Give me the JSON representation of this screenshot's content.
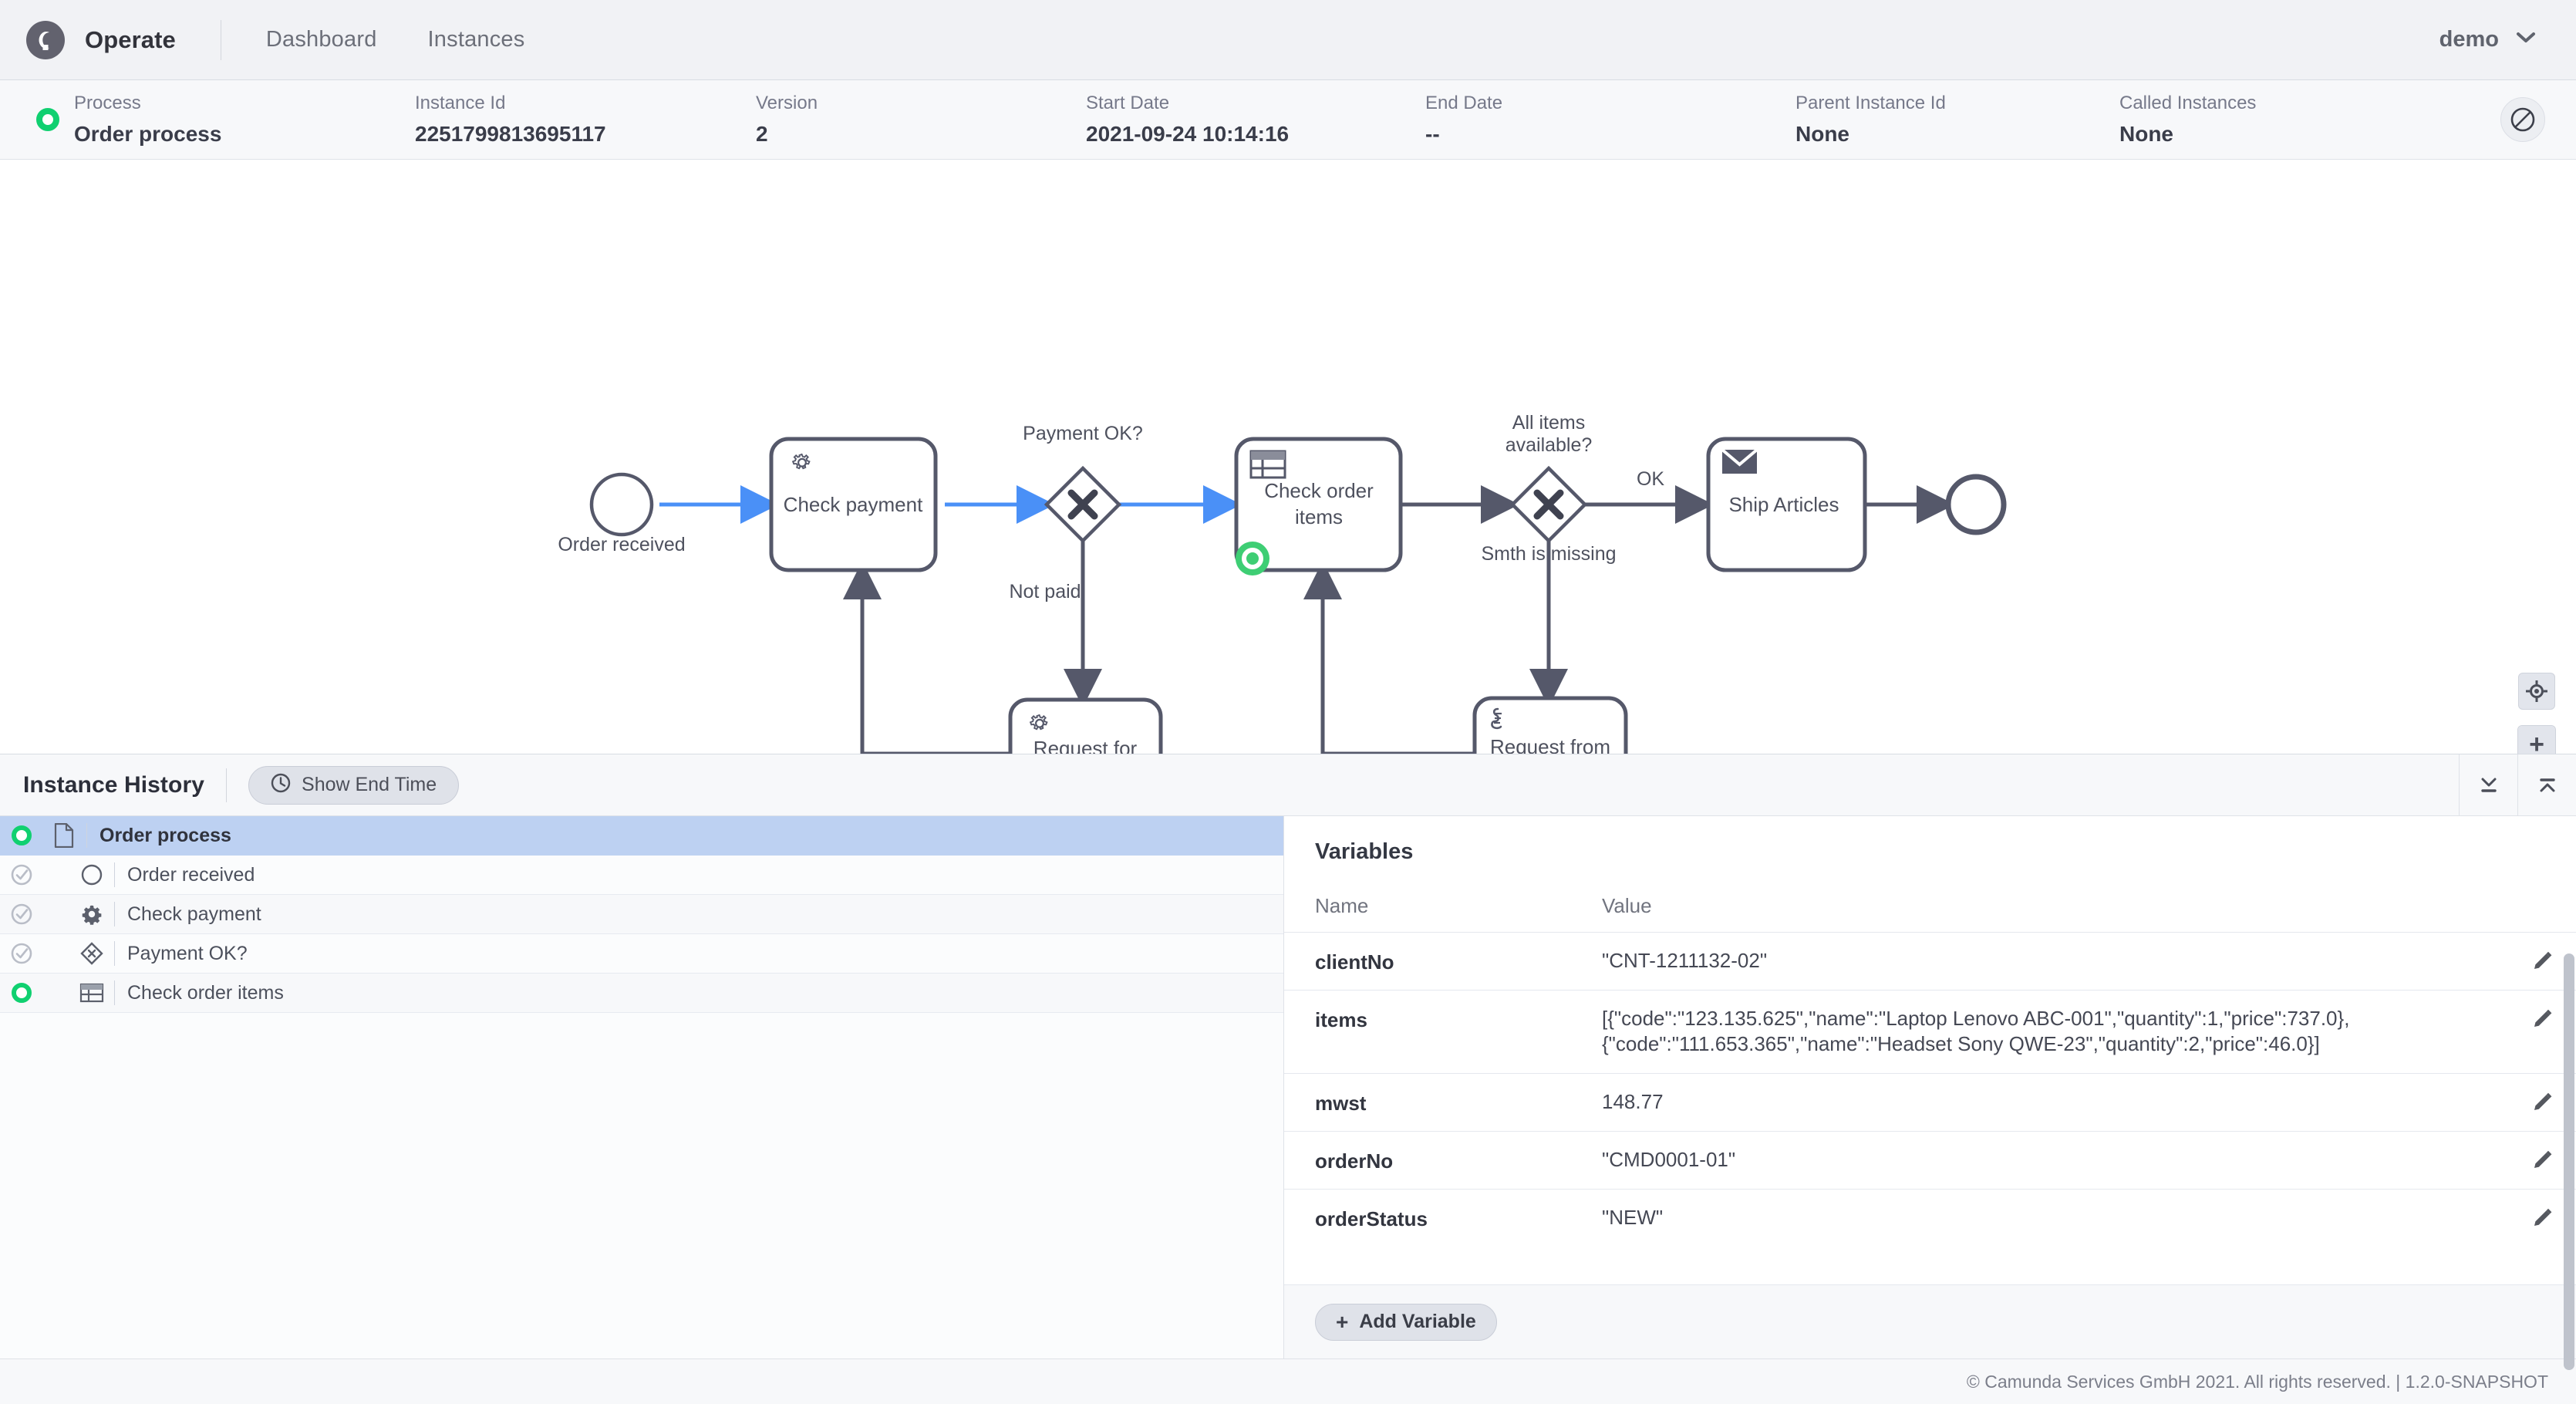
{
  "header": {
    "logo_icon": "camunda-logo-icon",
    "app_name": "Operate",
    "nav": [
      {
        "label": "Dashboard",
        "name": "nav-dashboard"
      },
      {
        "label": "Instances",
        "name": "nav-instances"
      }
    ],
    "user": "demo",
    "user_chevron_icon": "chevron-down-icon"
  },
  "instance_meta": {
    "state_icon": "active-instance-icon",
    "fields": [
      {
        "label": "Process",
        "value": "Order process"
      },
      {
        "label": "Instance Id",
        "value": "2251799813695117"
      },
      {
        "label": "Version",
        "value": "2"
      },
      {
        "label": "Start Date",
        "value": "2021-09-24 10:14:16"
      },
      {
        "label": "End Date",
        "value": "--"
      },
      {
        "label": "Parent Instance Id",
        "value": "None"
      },
      {
        "label": "Called Instances",
        "value": "None"
      }
    ],
    "cancel_icon": "cancel-operation-icon"
  },
  "diagram": {
    "elements": {
      "start_event": "Order received",
      "check_payment": "Check payment",
      "payment_gateway": "Payment OK?",
      "check_order_items": "Check order items",
      "items_gateway": "All items available?",
      "ship_articles": "Ship Articles",
      "request_for_payment": "Request for payment",
      "request_from_warehouse": "Request from warehouse"
    },
    "flow_labels": {
      "not_paid": "Not paid",
      "ok": "OK",
      "smth_missing": "Smth is missing"
    },
    "active_element": "Check order items",
    "colors": {
      "active_green": "#10d070",
      "completed_flow_blue": "#4a90f7",
      "stroke": "#55586a"
    }
  },
  "zoom_controls": {
    "reset_icon": "reset-zoom-icon",
    "zoom_in_icon": "plus-icon",
    "zoom_in_label": "+",
    "zoom_out_icon": "minus-icon",
    "zoom_out_label": "−"
  },
  "instance_history": {
    "title": "Instance History",
    "show_end_time_button": {
      "label": "Show End Time",
      "icon": "clock-icon"
    },
    "panel_controls": [
      {
        "name": "collapse-panel-down-icon"
      },
      {
        "name": "expand-panel-up-icon"
      }
    ],
    "rows": [
      {
        "label": "Order process",
        "icon": "process-document-icon",
        "state": "active",
        "level": 0,
        "selected": true
      },
      {
        "label": "Order received",
        "icon": "start-event-icon",
        "state": "completed",
        "level": 1,
        "selected": false
      },
      {
        "label": "Check payment",
        "icon": "service-task-icon",
        "state": "completed",
        "level": 1,
        "selected": false
      },
      {
        "label": "Payment OK?",
        "icon": "gateway-icon",
        "state": "completed",
        "level": 1,
        "selected": false
      },
      {
        "label": "Check order items",
        "icon": "business-rule-icon",
        "state": "active",
        "level": 1,
        "selected": false
      }
    ]
  },
  "variables": {
    "title": "Variables",
    "columns": {
      "name": "Name",
      "value": "Value"
    },
    "rows": [
      {
        "name": "clientNo",
        "value": "\"CNT-1211132-02\""
      },
      {
        "name": "items",
        "value": "[{\"code\":\"123.135.625\",\"name\":\"Laptop Lenovo ABC-001\",\"quantity\":1,\"price\":737.0},{\"code\":\"111.653.365\",\"name\":\"Headset Sony QWE-23\",\"quantity\":2,\"price\":46.0}]"
      },
      {
        "name": "mwst",
        "value": "148.77"
      },
      {
        "name": "orderNo",
        "value": "\"CMD0001-01\""
      },
      {
        "name": "orderStatus",
        "value": "\"NEW\""
      }
    ],
    "edit_icon": "pencil-edit-icon",
    "add_variable": {
      "plus": "+",
      "label": "Add Variable"
    }
  },
  "footer": {
    "text": "© Camunda Services GmbH 2021. All rights reserved. | 1.2.0-SNAPSHOT"
  }
}
